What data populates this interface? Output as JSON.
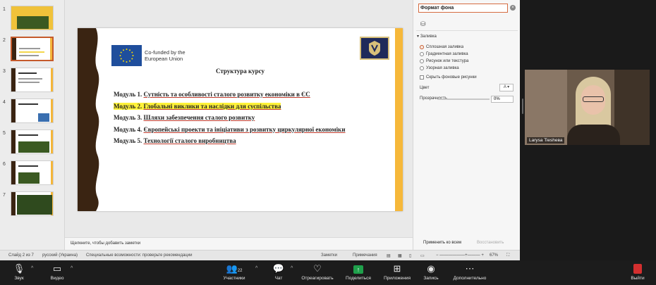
{
  "thumbnails": [
    {
      "num": "1"
    },
    {
      "num": "2",
      "active": true
    },
    {
      "num": "3"
    },
    {
      "num": "4"
    },
    {
      "num": "5"
    },
    {
      "num": "6"
    },
    {
      "num": "7"
    }
  ],
  "slide": {
    "eu_text_line1": "Co-funded by the",
    "eu_text_line2": "European Union",
    "title": "Структура курсу",
    "modules": [
      {
        "prefix": "Модуль 1. ",
        "text": "Сутність та особливості сталого розвитку економіки в ЄС"
      },
      {
        "prefix": "Модуль 2. ",
        "text": "Глобальні виклики та наслідки для суспільства"
      },
      {
        "prefix": "Модуль 3. ",
        "text": "Шляхи забезпечення сталого розвитку"
      },
      {
        "prefix": "Модуль 4. ",
        "text": "Європейські проекти та ініціативи з розвитку циркулярної економіки"
      },
      {
        "prefix": "Модуль 5. ",
        "text": "Технології сталого виробництва"
      }
    ]
  },
  "notes_placeholder": "Щелкните, чтобы добавить заметки",
  "pane": {
    "title": "Формат фона",
    "section": "Заливка",
    "options": [
      "Сплошная заливка",
      "Градиентная заливка",
      "Рисунок или текстура",
      "Узорная заливка"
    ],
    "hide_bg": "Скрыть фоновые рисунки",
    "color_label": "Цвет",
    "transparency_label": "Прозрачность",
    "transparency_value": "0%",
    "apply_all": "Применить ко всем",
    "reset": "Восстановить"
  },
  "status": {
    "slide": "Слайд 2 из 7",
    "language": "русский (Украина)",
    "accessibility": "Специальные возможности: проверьте рекомендации",
    "notes": "Заметки",
    "comments": "Примечания",
    "zoom": "67%"
  },
  "video": {
    "name": "Larysa Tieshева"
  },
  "toolbar": {
    "audio": "Звук",
    "video": "Видео",
    "participants": "Участники",
    "participants_count": "22",
    "chat": "Чат",
    "react": "Отреагировать",
    "share": "Поделиться",
    "apps": "Приложения",
    "record": "Запись",
    "more": "Дополнительно",
    "exit": "Выйти"
  },
  "colors": {
    "accent": "#c55a2b",
    "slide_left_deco": "#3a2412",
    "slide_right_bar": "#f6b83a",
    "highlight": "#fff23a",
    "share_green": "#1fa04b"
  }
}
